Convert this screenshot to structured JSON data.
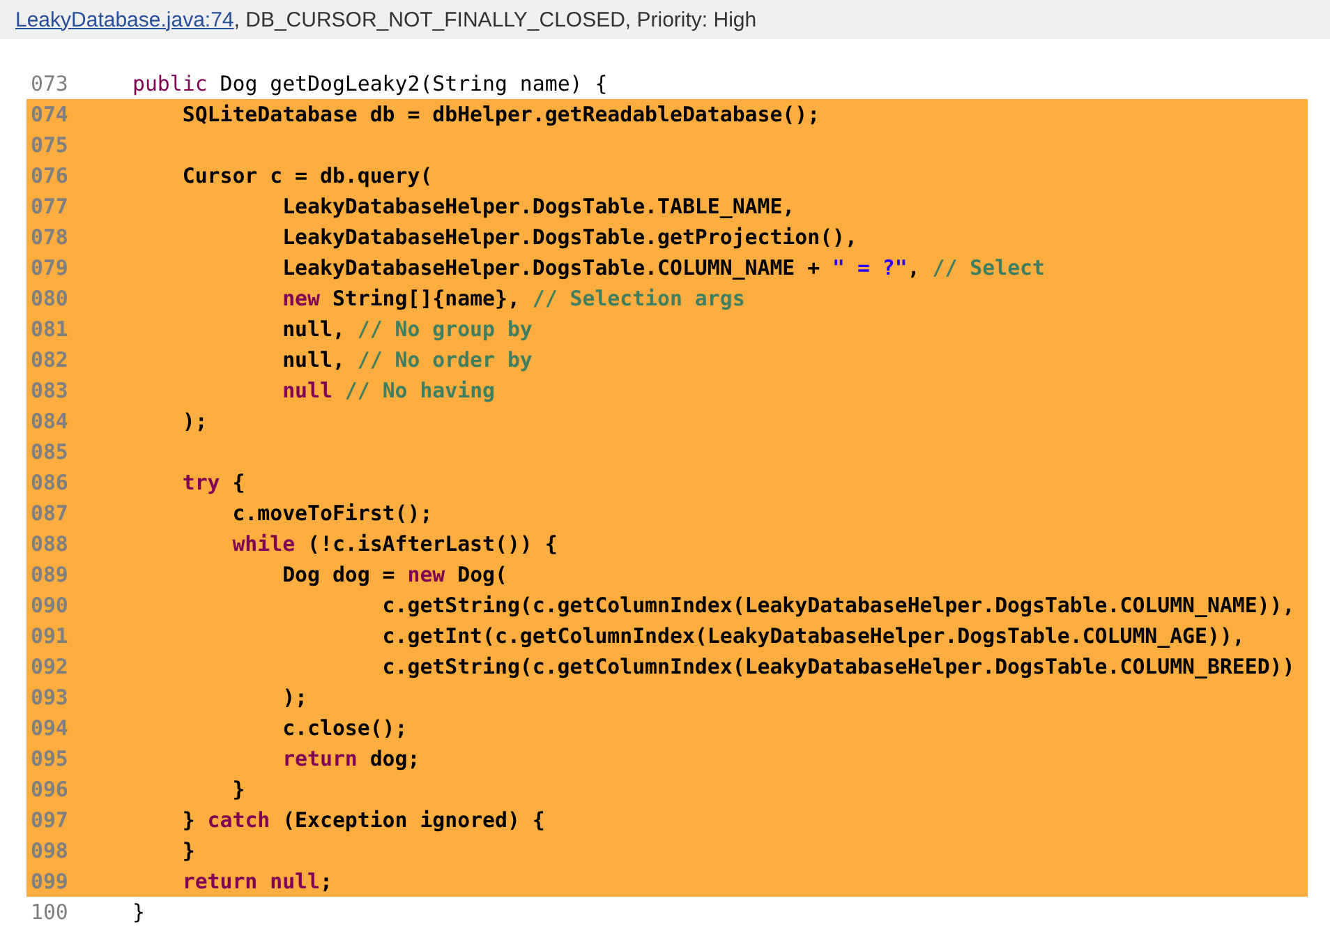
{
  "header": {
    "link": "LeakyDatabase.java:74",
    "text": ", DB_CURSOR_NOT_FINALLY_CLOSED, Priority: High"
  },
  "lines": [
    {
      "number": "073",
      "highlighted": false,
      "tokens": [
        {
          "kind": "keyword",
          "text": "public"
        },
        {
          "kind": "plain",
          "text": " Dog getDogLeaky2(String name) {"
        }
      ]
    },
    {
      "number": "074",
      "highlighted": true,
      "tokens": [
        {
          "kind": "plain",
          "text": "    SQLiteDatabase db = dbHelper.getReadableDatabase();"
        }
      ]
    },
    {
      "number": "075",
      "highlighted": true
    },
    {
      "number": "076",
      "highlighted": true,
      "tokens": [
        {
          "kind": "plain",
          "text": "    Cursor c = db.query("
        }
      ]
    },
    {
      "number": "077",
      "highlighted": true,
      "tokens": [
        {
          "kind": "plain",
          "text": "            LeakyDatabaseHelper.DogsTable.TABLE_NAME,"
        }
      ]
    },
    {
      "number": "078",
      "highlighted": true,
      "tokens": [
        {
          "kind": "plain",
          "text": "            LeakyDatabaseHelper.DogsTable.getProjection(),"
        }
      ]
    },
    {
      "number": "079",
      "highlighted": true,
      "tokens": [
        {
          "kind": "plain",
          "text": "            LeakyDatabaseHelper.DogsTable.COLUMN_NAME + "
        },
        {
          "kind": "string",
          "text": "\" = ?\""
        },
        {
          "kind": "plain",
          "text": ", "
        },
        {
          "kind": "comment",
          "text": "// Select"
        }
      ]
    },
    {
      "number": "080",
      "highlighted": true,
      "tokens": [
        {
          "kind": "keyword",
          "text": "            new"
        },
        {
          "kind": "plain",
          "text": " String[]{name}, "
        },
        {
          "kind": "comment",
          "text": "// Selection args"
        }
      ]
    },
    {
      "number": "081",
      "highlighted": true,
      "tokens": [
        {
          "kind": "plain",
          "text": "            null, "
        },
        {
          "kind": "comment",
          "text": "// No group by"
        }
      ]
    },
    {
      "number": "082",
      "highlighted": true,
      "tokens": [
        {
          "kind": "plain",
          "text": "            null, "
        },
        {
          "kind": "comment",
          "text": "// No order by"
        }
      ]
    },
    {
      "number": "083",
      "highlighted": true,
      "tokens": [
        {
          "kind": "keyword",
          "text": "            null"
        },
        {
          "kind": "comment",
          "text": " // No having"
        }
      ]
    },
    {
      "number": "084",
      "highlighted": true,
      "tokens": [
        {
          "kind": "plain",
          "text": "    );"
        }
      ]
    },
    {
      "number": "085",
      "highlighted": true
    },
    {
      "number": "086",
      "highlighted": true,
      "tokens": [
        {
          "kind": "keyword",
          "text": "    try"
        },
        {
          "kind": "plain",
          "text": " {"
        }
      ]
    },
    {
      "number": "087",
      "highlighted": true,
      "tokens": [
        {
          "kind": "plain",
          "text": "        c.moveToFirst();"
        }
      ]
    },
    {
      "number": "088",
      "highlighted": true,
      "tokens": [
        {
          "kind": "keyword",
          "text": "        while"
        },
        {
          "kind": "plain",
          "text": " (!c.isAfterLast()) {"
        }
      ]
    },
    {
      "number": "089",
      "highlighted": true,
      "tokens": [
        {
          "kind": "plain",
          "text": "            Dog dog = "
        },
        {
          "kind": "keyword",
          "text": "new"
        },
        {
          "kind": "plain",
          "text": " Dog("
        }
      ]
    },
    {
      "number": "090",
      "highlighted": true,
      "tokens": [
        {
          "kind": "plain",
          "text": "                    c.getString(c.getColumnIndex(LeakyDatabaseHelper.DogsTable.COLUMN_NAME)),"
        }
      ]
    },
    {
      "number": "091",
      "highlighted": true,
      "tokens": [
        {
          "kind": "plain",
          "text": "                    c.getInt(c.getColumnIndex(LeakyDatabaseHelper.DogsTable.COLUMN_AGE)),"
        }
      ]
    },
    {
      "number": "092",
      "highlighted": true,
      "tokens": [
        {
          "kind": "plain",
          "text": "                    c.getString(c.getColumnIndex(LeakyDatabaseHelper.DogsTable.COLUMN_BREED))"
        }
      ]
    },
    {
      "number": "093",
      "highlighted": true,
      "tokens": [
        {
          "kind": "plain",
          "text": "            );"
        }
      ]
    },
    {
      "number": "094",
      "highlighted": true,
      "tokens": [
        {
          "kind": "plain",
          "text": "            c.close();"
        }
      ]
    },
    {
      "number": "095",
      "highlighted": true,
      "tokens": [
        {
          "kind": "keyword",
          "text": "            return"
        },
        {
          "kind": "plain",
          "text": " dog;"
        }
      ]
    },
    {
      "number": "096",
      "highlighted": true,
      "tokens": [
        {
          "kind": "plain",
          "text": "        }"
        }
      ]
    },
    {
      "number": "097",
      "highlighted": true,
      "tokens": [
        {
          "kind": "plain",
          "text": "    } "
        },
        {
          "kind": "keyword",
          "text": "catch"
        },
        {
          "kind": "plain",
          "text": " (Exception ignored) {"
        }
      ]
    },
    {
      "number": "098",
      "highlighted": true,
      "tokens": [
        {
          "kind": "plain",
          "text": "    }"
        }
      ]
    },
    {
      "number": "099",
      "highlighted": true,
      "tokens": [
        {
          "kind": "keyword",
          "text": "    return"
        },
        {
          "kind": "keyword",
          "text": " null"
        },
        {
          "kind": "plain",
          "text": ";"
        }
      ]
    },
    {
      "number": "100",
      "highlighted": false,
      "tokens": [
        {
          "kind": "plain",
          "text": "}"
        }
      ]
    }
  ]
}
